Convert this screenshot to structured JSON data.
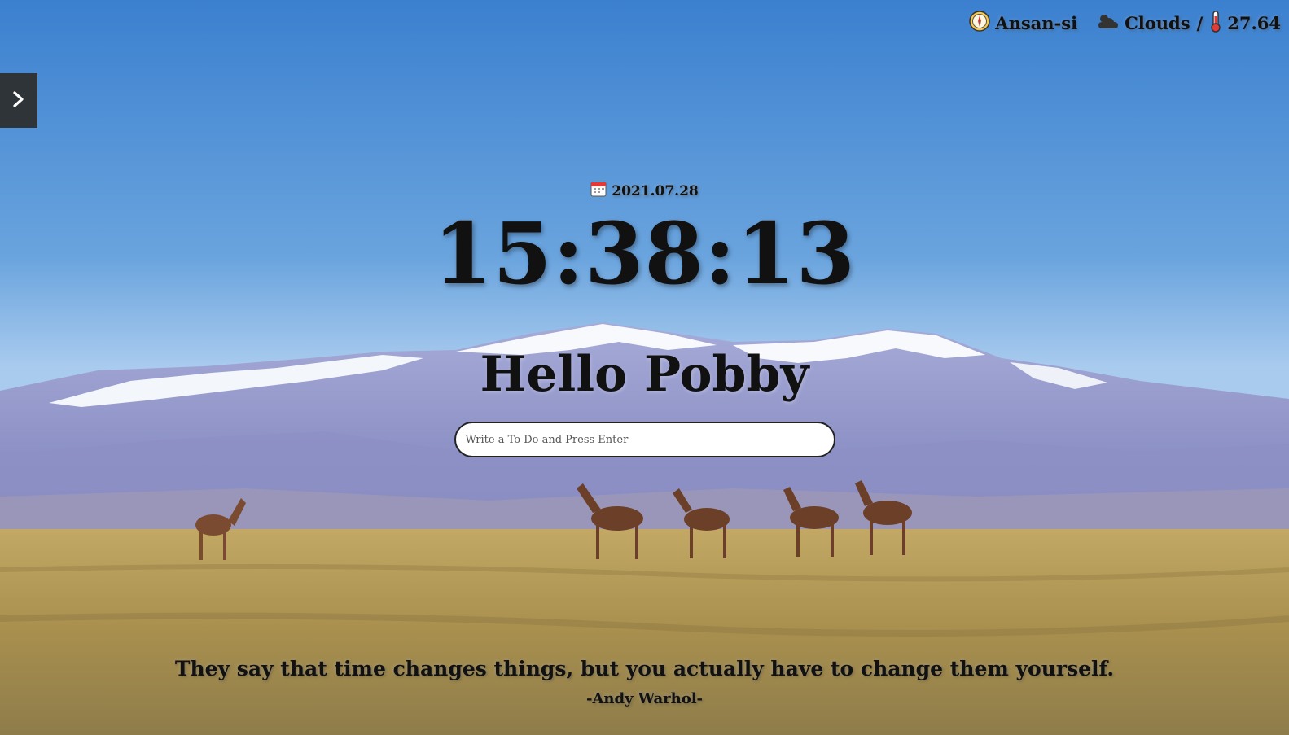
{
  "weather": {
    "location": "Ansan-si",
    "condition": "Clouds",
    "separator": "/",
    "temperature": "27.64"
  },
  "date": "2021.07.28",
  "clock": "15:38:13",
  "greeting": "Hello Pobby",
  "todo": {
    "placeholder": "Write a To Do and Press Enter",
    "value": ""
  },
  "quote": {
    "text": "They say that time changes things, but you actually have to change them yourself.",
    "author": "-Andy Warhol-"
  },
  "icons": {
    "location": "compass-icon",
    "weather": "cloud-sun-icon",
    "temperature": "thermometer-icon",
    "date": "calendar-icon",
    "sidebar": "chevron-right-icon"
  },
  "colors": {
    "sky_top": "#3d82d0",
    "sky_bottom": "#b9d6f0",
    "snow": "#f4f7fb",
    "mountain": "#8f96cc",
    "grass": "#b59a55",
    "sidebar_bg": "#2f3438",
    "text": "#111111"
  }
}
